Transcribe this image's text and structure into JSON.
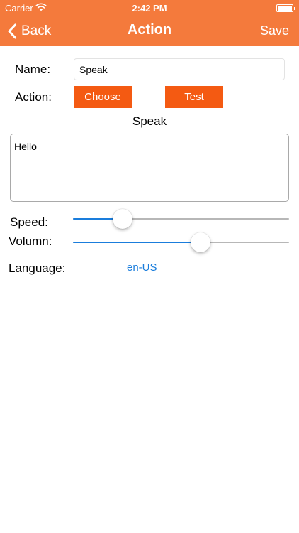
{
  "status_bar": {
    "carrier": "Carrier",
    "time": "2:42 PM",
    "wifi_icon": "wifi-icon",
    "battery_icon": "battery-icon"
  },
  "nav": {
    "back_label": "Back",
    "back_icon": "chevron-left-icon",
    "title": "Action",
    "save_label": "Save"
  },
  "form": {
    "name_label": "Name:",
    "name_value": "Speak",
    "action_label": "Action:",
    "choose_label": "Choose",
    "test_label": "Test",
    "action_name": "Speak",
    "speech_text": "Hello",
    "speed_label": "Speed:",
    "speed_value": 0.23,
    "volume_label": "Volumn:",
    "volume_value": 0.59,
    "language_label": "Language:",
    "language_value": "en-US"
  },
  "colors": {
    "nav_bar": "#f47a3c",
    "button": "#f45a12",
    "accent": "#1a7ddc"
  }
}
